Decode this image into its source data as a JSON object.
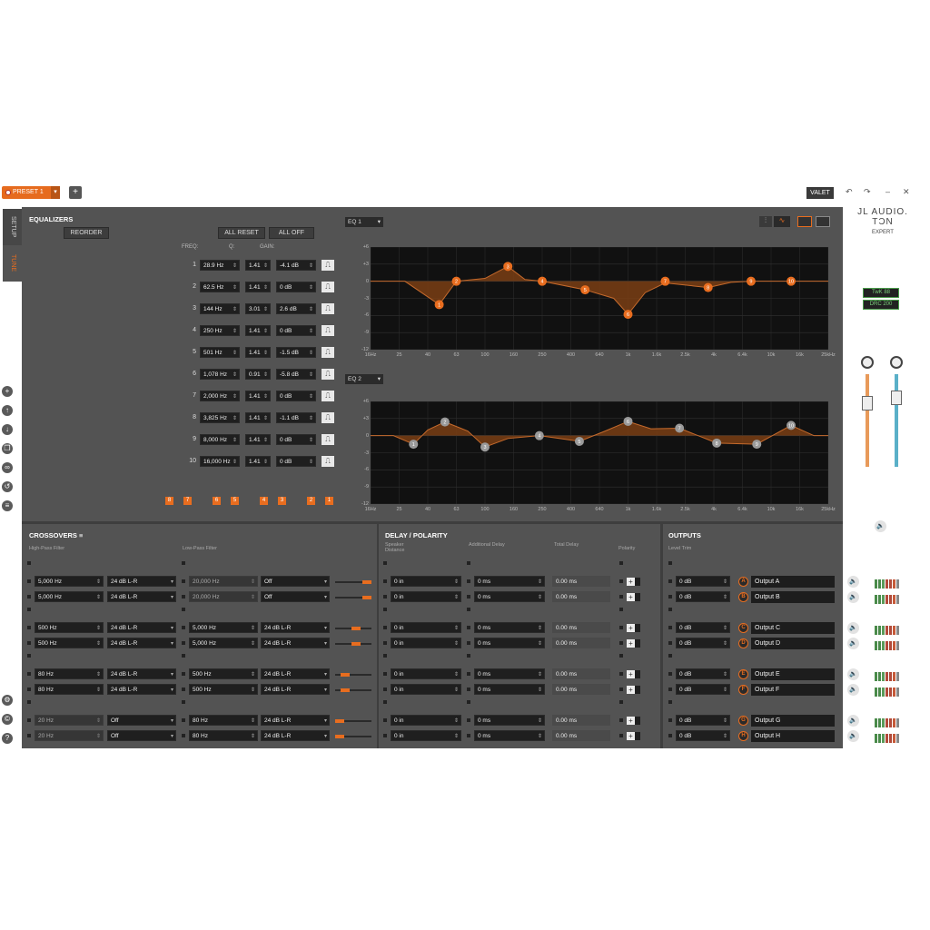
{
  "preset": {
    "label": "PRESET 1"
  },
  "window": {
    "valet": "VALET"
  },
  "brand": {
    "line1": "JL AUDIO.",
    "line2": "TƆN",
    "line3": "EXPERT",
    "tag1": "TwK 88",
    "tag2": "DRC 200"
  },
  "tabs": {
    "setup": "SETUP",
    "tune": "TUNE"
  },
  "equalizers": {
    "title": "EQUALIZERS",
    "reorder": "REORDER",
    "all_reset": "ALL RESET",
    "all_off": "ALL OFF",
    "col_freq": "FREQ:",
    "col_q": "Q:",
    "col_gain": "GAIN:",
    "bands": [
      {
        "n": "1",
        "freq": "28.9 Hz",
        "q": "1.41",
        "gain": "-4.1 dB"
      },
      {
        "n": "2",
        "freq": "62.5 Hz",
        "q": "1.41",
        "gain": "0 dB"
      },
      {
        "n": "3",
        "freq": "144 Hz",
        "q": "3.01",
        "gain": "2.6 dB"
      },
      {
        "n": "4",
        "freq": "250 Hz",
        "q": "1.41",
        "gain": "0 dB"
      },
      {
        "n": "5",
        "freq": "501 Hz",
        "q": "1.41",
        "gain": "-1.5 dB"
      },
      {
        "n": "6",
        "freq": "1,078 Hz",
        "q": "0.91",
        "gain": "-5.8 dB"
      },
      {
        "n": "7",
        "freq": "2,000 Hz",
        "q": "1.41",
        "gain": "0 dB"
      },
      {
        "n": "8",
        "freq": "3,825 Hz",
        "q": "1.41",
        "gain": "-1.1 dB"
      },
      {
        "n": "9",
        "freq": "8,000 Hz",
        "q": "1.41",
        "gain": "0 dB"
      },
      {
        "n": "10",
        "freq": "16,000 Hz",
        "q": "1.41",
        "gain": "0 dB"
      }
    ],
    "band_tags": [
      "8",
      "7",
      "6",
      "5",
      "4",
      "3",
      "2",
      "1"
    ]
  },
  "eq1": {
    "select": "EQ 1"
  },
  "eq2": {
    "select": "EQ 2"
  },
  "graph_axis": {
    "y": [
      "+6",
      "+3",
      "0",
      "-3",
      "-6",
      "-9",
      "-12"
    ],
    "x": [
      "16Hz",
      "25",
      "40",
      "63",
      "100",
      "160",
      "250",
      "400",
      "640",
      "1k",
      "1.6k",
      "2.5k",
      "4k",
      "6.4k",
      "10k",
      "16k",
      "25kHz"
    ]
  },
  "crossovers": {
    "title": "CROSSOVERS",
    "hpf": "High-Pass Filter",
    "lpf": "Low-Pass Filter",
    "rows": [
      {
        "hp": "5,000 Hz",
        "hps": "24 dB L-R",
        "lp": "20,000 Hz",
        "lps": "Off"
      },
      {
        "hp": "5,000 Hz",
        "hps": "24 dB L-R",
        "lp": "20,000 Hz",
        "lps": "Off"
      },
      {
        "hp": "500 Hz",
        "hps": "24 dB L-R",
        "lp": "5,000 Hz",
        "lps": "24 dB L-R"
      },
      {
        "hp": "500 Hz",
        "hps": "24 dB L-R",
        "lp": "5,000 Hz",
        "lps": "24 dB L-R"
      },
      {
        "hp": "80 Hz",
        "hps": "24 dB L-R",
        "lp": "500 Hz",
        "lps": "24 dB L-R"
      },
      {
        "hp": "80 Hz",
        "hps": "24 dB L-R",
        "lp": "500 Hz",
        "lps": "24 dB L-R"
      },
      {
        "hp": "20 Hz",
        "hps": "Off",
        "lp": "80 Hz",
        "lps": "24 dB L-R"
      },
      {
        "hp": "20 Hz",
        "hps": "Off",
        "lp": "80 Hz",
        "lps": "24 dB L-R"
      }
    ]
  },
  "delay": {
    "title": "DELAY / POLARITY",
    "c1": "Speaker Distance",
    "c2": "Additional Delay",
    "c3": "Total Delay",
    "c4": "Polarity",
    "dist": "0 in",
    "add": "0 ms",
    "total": "0.00 ms"
  },
  "outputs": {
    "title": "OUTPUTS",
    "level": "Level Trim",
    "rows": [
      {
        "trim": "0 dB",
        "letter": "A",
        "name": "Output A"
      },
      {
        "trim": "0 dB",
        "letter": "B",
        "name": "Output B"
      },
      {
        "trim": "0 dB",
        "letter": "C",
        "name": "Output C"
      },
      {
        "trim": "0 dB",
        "letter": "D",
        "name": "Output D"
      },
      {
        "trim": "0 dB",
        "letter": "E",
        "name": "Output E"
      },
      {
        "trim": "0 dB",
        "letter": "F",
        "name": "Output F"
      },
      {
        "trim": "0 dB",
        "letter": "G",
        "name": "Output G"
      },
      {
        "trim": "0 dB",
        "letter": "H",
        "name": "Output H"
      }
    ]
  },
  "colors": {
    "accent": "#e86d1f",
    "panel": "#535353",
    "graph_bg": "#111111"
  }
}
